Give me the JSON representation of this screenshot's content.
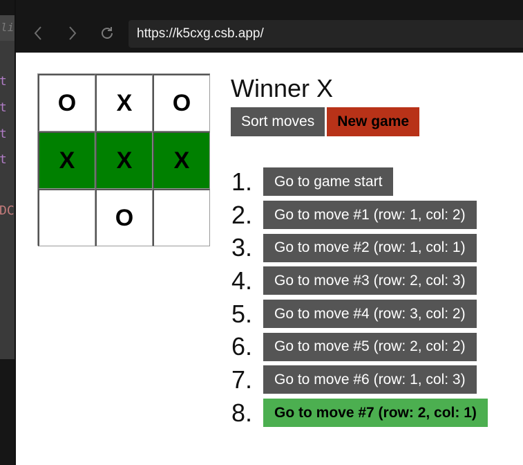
{
  "editor": {
    "tab_text": "li",
    "code_lines": [
      {
        "text": "t",
        "kind": "kw"
      },
      {
        "text": "t",
        "kind": "kw"
      },
      {
        "text": "t",
        "kind": "kw"
      },
      {
        "text": "t",
        "kind": "kw"
      },
      {
        "text": "DC",
        "kind": "tag"
      }
    ]
  },
  "browser": {
    "back_icon": "chevron-left-icon",
    "forward_icon": "chevron-right-icon",
    "reload_icon": "reload-icon",
    "url": "https://k5cxg.csb.app/"
  },
  "game": {
    "board": [
      [
        "O",
        "X",
        "O"
      ],
      [
        "X",
        "X",
        "X"
      ],
      [
        "",
        "O",
        ""
      ]
    ],
    "winning_row": 1,
    "win_color": "#008000",
    "status": "Winner X",
    "sort_label": "Sort moves",
    "new_game_label": "New game",
    "new_game_color": "#b83218",
    "moves": [
      {
        "num": "1.",
        "label": "Go to game start",
        "current": false
      },
      {
        "num": "2.",
        "label": "Go to move #1 (row: 1, col: 2)",
        "current": false
      },
      {
        "num": "3.",
        "label": "Go to move #2 (row: 1, col: 1)",
        "current": false
      },
      {
        "num": "4.",
        "label": "Go to move #3 (row: 2, col: 3)",
        "current": false
      },
      {
        "num": "5.",
        "label": "Go to move #4 (row: 3, col: 2)",
        "current": false
      },
      {
        "num": "6.",
        "label": "Go to move #5 (row: 2, col: 2)",
        "current": false
      },
      {
        "num": "7.",
        "label": "Go to move #6 (row: 1, col: 3)",
        "current": false
      },
      {
        "num": "8.",
        "label": "Go to move #7 (row: 2, col: 1)",
        "current": true
      }
    ],
    "move_button_color": "#555555",
    "current_move_color": "#4caf50"
  }
}
